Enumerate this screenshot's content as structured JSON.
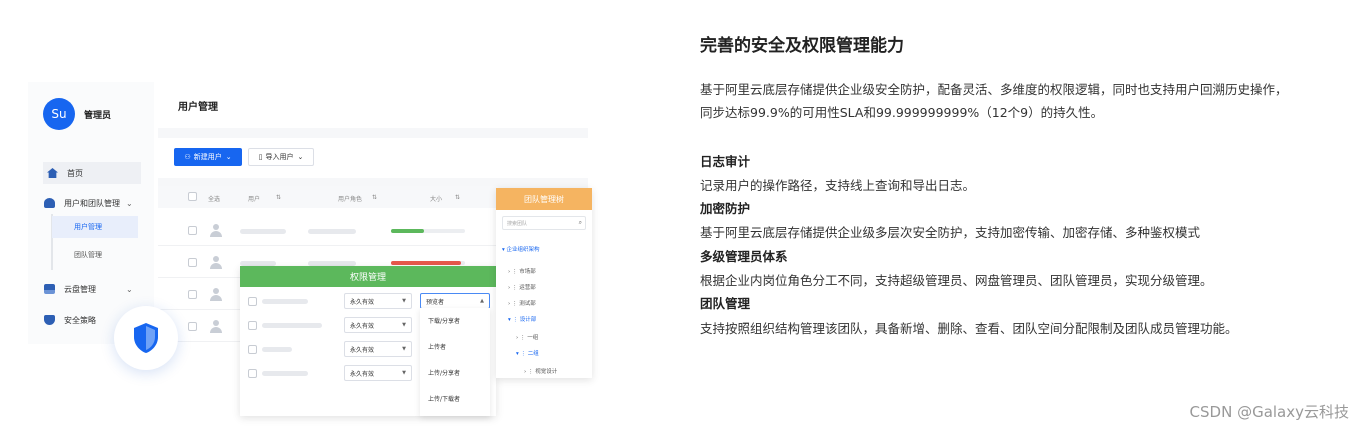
{
  "illustration": {
    "sidebar": {
      "avatar_text": "Su",
      "admin_name": "管理员",
      "items": [
        {
          "label": "首页",
          "icon": "home-icon"
        },
        {
          "label": "用户和团队管理",
          "icon": "user-icon"
        },
        {
          "label": "云盘管理",
          "icon": "cloud-icon"
        },
        {
          "label": "安全策略",
          "icon": "shield-icon"
        }
      ],
      "sub_items": [
        {
          "label": "用户管理",
          "active": true
        },
        {
          "label": "团队管理",
          "active": false
        }
      ]
    },
    "main": {
      "title": "用户管理",
      "new_user_button": "新建用户",
      "import_user_button": "导入用户",
      "table_headers": {
        "select_all": "全选",
        "user": "用户",
        "role": "用户角色",
        "size": "大小"
      },
      "usage_bars": [
        {
          "fill": 0.45,
          "color": "#5cb85c"
        },
        {
          "fill": 0.95,
          "color": "#e8584c"
        }
      ]
    },
    "permission_panel": {
      "title": "权限管理",
      "validity_options": [
        "永久有效",
        "永久有效",
        "永久有效",
        "永久有效"
      ],
      "selected_role": "预览者",
      "dropdown_options": [
        "下载/分享者",
        "上传者",
        "上传/分享者",
        "上传/下载者"
      ]
    },
    "team_tree": {
      "title": "团队管理树",
      "search_placeholder": "搜索团队",
      "root": "企业组织架构",
      "nodes": [
        "市场部",
        "运营部",
        "测试部",
        "设计部",
        "一组",
        "二组",
        "视觉设计"
      ]
    }
  },
  "content": {
    "title": "完善的安全及权限管理能力",
    "intro_line1": "基于阿里云底层存储提供企业级安全防护，配备灵活、多维度的权限逻辑，同时也支持用户回溯历史操作，",
    "intro_line2": "同步达标99.9%的可用性SLA和99.999999999%（12个9）的持久性。",
    "sections": [
      {
        "heading": "日志审计",
        "text": "记录用户的操作路径，支持线上查询和导出日志。"
      },
      {
        "heading": "加密防护",
        "text": "基于阿里云底层存储提供企业级多层次安全防护，支持加密传输、加密存储、多种鉴权模式"
      },
      {
        "heading": "多级管理员体系",
        "text": "根据企业内岗位角色分工不同，支持超级管理员、网盘管理员、团队管理员，实现分级管理。"
      },
      {
        "heading": "团队管理",
        "text": "支持按照组织结构管理该团队，具备新增、删除、查看、团队空间分配限制及团队成员管理功能。"
      }
    ]
  },
  "watermark": "CSDN @Galaxy云科技",
  "colors": {
    "primary": "#1766f0",
    "permission_header": "#5cb85c",
    "tree_header": "#f5b461"
  }
}
